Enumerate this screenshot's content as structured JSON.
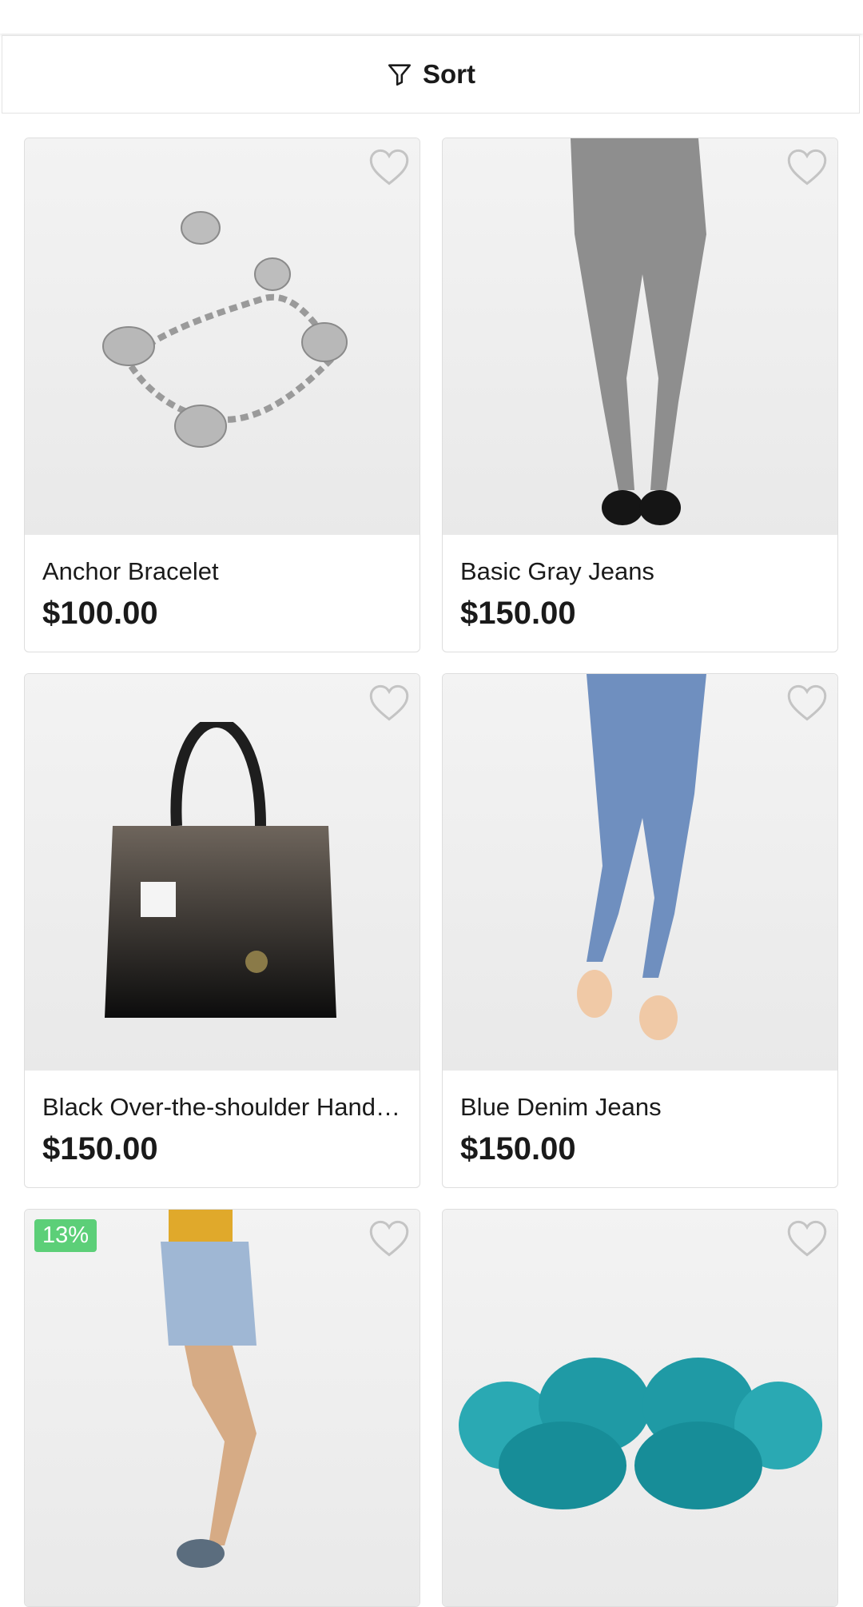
{
  "sort": {
    "label": "Sort",
    "icon": "filter-funnel-icon"
  },
  "products": [
    {
      "name": "Anchor Bracelet",
      "price": "$100.00",
      "favorite_icon": "heart-outline-icon"
    },
    {
      "name": "Basic Gray Jeans",
      "price": "$150.00",
      "favorite_icon": "heart-outline-icon"
    },
    {
      "name": "Black Over-the-shoulder Handbag",
      "price": "$150.00",
      "favorite_icon": "heart-outline-icon"
    },
    {
      "name": "Blue Denim Jeans",
      "price": "$150.00",
      "favorite_icon": "heart-outline-icon"
    },
    {
      "name": "",
      "price": "",
      "badge": "13%",
      "favorite_icon": "heart-outline-icon"
    },
    {
      "name": "",
      "price": "",
      "favorite_icon": "heart-outline-icon"
    }
  ],
  "colors": {
    "badge": "#5ccf78",
    "heart": "#c4c4c4",
    "text": "#1a1a1a"
  }
}
